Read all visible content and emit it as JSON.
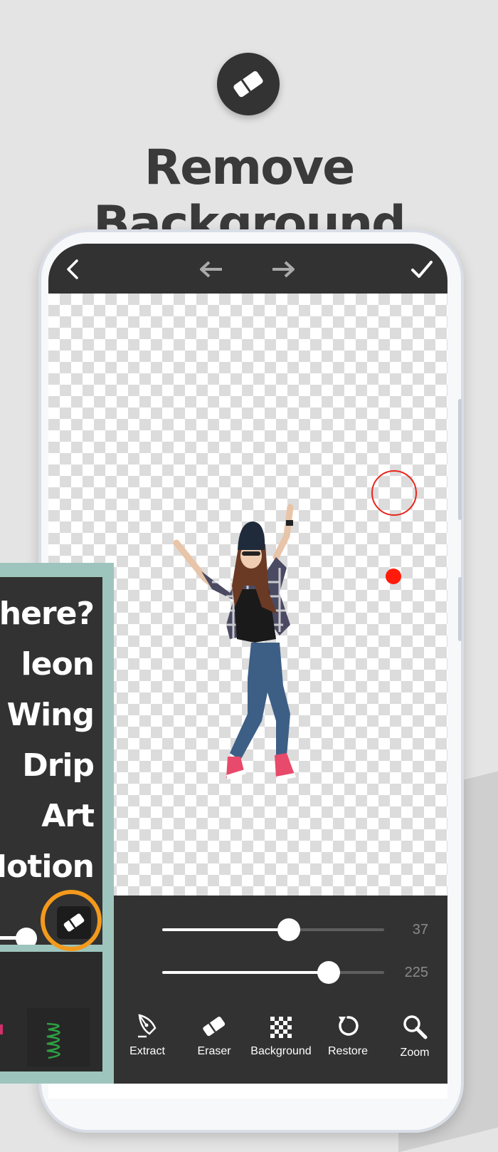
{
  "header": {
    "icon": "eraser-icon",
    "title": "Remove Background"
  },
  "topbar": {
    "back_icon": "chevron-left-icon",
    "undo_icon": "arrow-left-icon",
    "redo_icon": "arrow-right-icon",
    "done_icon": "checkmark-icon"
  },
  "sliders": [
    {
      "value": "37",
      "fraction": 0.57
    },
    {
      "value": "225",
      "fraction": 0.75
    }
  ],
  "tools": [
    {
      "label": "Extract",
      "icon": "pen-nib-icon"
    },
    {
      "label": "Eraser",
      "icon": "eraser-icon"
    },
    {
      "label": "Background",
      "icon": "checkerboard-icon"
    },
    {
      "label": "Restore",
      "icon": "restore-icon"
    },
    {
      "label": "Zoom",
      "icon": "magnifier-icon"
    }
  ],
  "overlay": {
    "lines": [
      "here?",
      "leon",
      "Wing",
      "Drip",
      "Art",
      "Motion"
    ],
    "slider_fraction": 1.0
  },
  "colors": {
    "brush": "#e8261c",
    "highlight_ring": "#f39a1c",
    "overlay_bg": "#9ec5bd",
    "toolbar_bg": "#323232"
  }
}
